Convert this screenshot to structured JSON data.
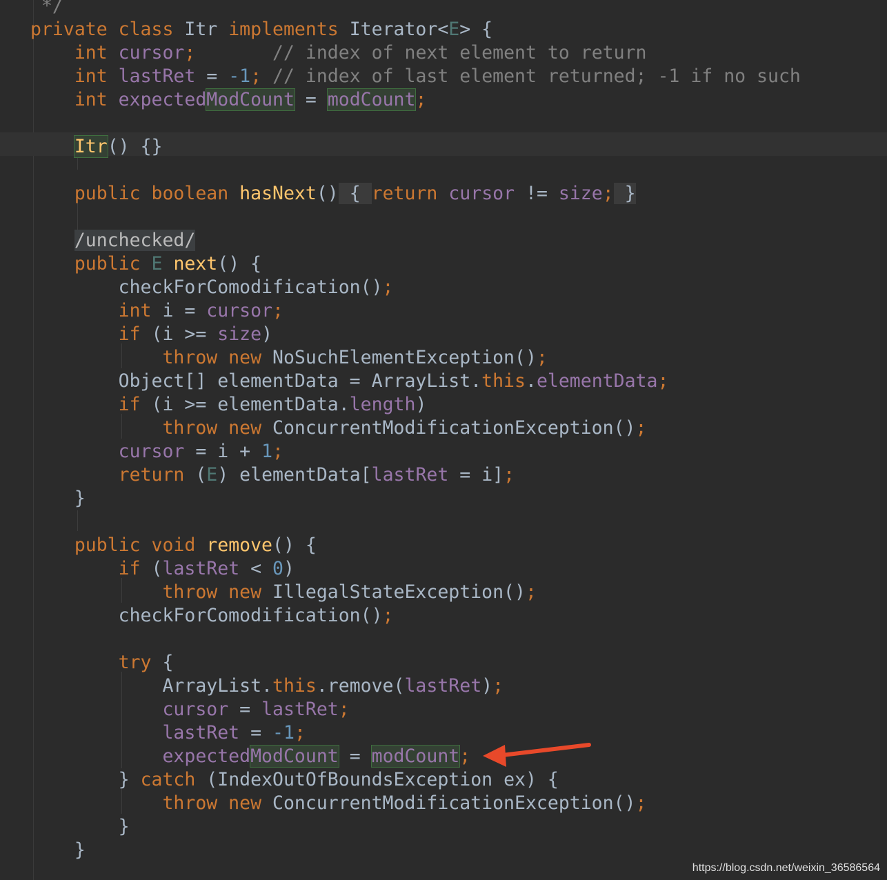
{
  "lines": [
    [
      {
        "t": " */",
        "c": "cmt"
      }
    ],
    [
      {
        "t": "private class ",
        "c": "kw"
      },
      {
        "t": "Itr ",
        "c": "plain"
      },
      {
        "t": "implements ",
        "c": "kw"
      },
      {
        "t": "Iterator<",
        "c": "plain"
      },
      {
        "t": "E",
        "c": "tp"
      },
      {
        "t": "> {",
        "c": "plain"
      }
    ],
    [
      {
        "t": "    "
      },
      {
        "t": "int ",
        "c": "kw"
      },
      {
        "t": "cursor",
        "c": "fld"
      },
      {
        "t": ";",
        "c": "kw"
      },
      {
        "t": "       // index of next element to return",
        "c": "cmt"
      }
    ],
    [
      {
        "t": "    "
      },
      {
        "t": "int ",
        "c": "kw"
      },
      {
        "t": "lastRet",
        "c": "fld"
      },
      {
        "t": " = ",
        "c": "plain"
      },
      {
        "t": "-1",
        "c": "num"
      },
      {
        "t": "; ",
        "c": "kw"
      },
      {
        "t": "// index of last element returned; -1 if no such",
        "c": "cmt"
      }
    ],
    [
      {
        "t": "    "
      },
      {
        "t": "int ",
        "c": "kw"
      },
      {
        "t": "expected",
        "c": "fld"
      },
      {
        "t": "ModCount",
        "c": "fld hl-green"
      },
      {
        "t": " = ",
        "c": "plain"
      },
      {
        "t": "modCount",
        "c": "fld hl-green"
      },
      {
        "t": ";",
        "c": "kw"
      }
    ],
    [],
    [
      {
        "t": "    "
      },
      {
        "t": "Itr",
        "c": "fn hl-green"
      },
      {
        "t": "() {}",
        "c": "plain"
      }
    ],
    [],
    [
      {
        "t": "    "
      },
      {
        "t": "public boolean ",
        "c": "kw"
      },
      {
        "t": "hasNext",
        "c": "fn"
      },
      {
        "t": "()",
        "c": "plain"
      },
      {
        "t": " { ",
        "c": "plain fold-bg"
      },
      {
        "t": "return ",
        "c": "kw"
      },
      {
        "t": "cursor",
        "c": "fld"
      },
      {
        "t": " != ",
        "c": "plain"
      },
      {
        "t": "size",
        "c": "fld"
      },
      {
        "t": ";",
        "c": "kw"
      },
      {
        "t": " }",
        "c": "plain fold-bg"
      }
    ],
    [],
    [
      {
        "t": "    "
      },
      {
        "t": "/unchecked/",
        "c": "annot-bg"
      }
    ],
    [
      {
        "t": "    "
      },
      {
        "t": "public ",
        "c": "kw"
      },
      {
        "t": "E ",
        "c": "tp"
      },
      {
        "t": "next",
        "c": "fn"
      },
      {
        "t": "() {",
        "c": "plain"
      }
    ],
    [
      {
        "t": "        "
      },
      {
        "t": "checkForComodification()",
        "c": "plain"
      },
      {
        "t": ";",
        "c": "kw"
      }
    ],
    [
      {
        "t": "        "
      },
      {
        "t": "int ",
        "c": "kw"
      },
      {
        "t": "i = ",
        "c": "plain"
      },
      {
        "t": "cursor",
        "c": "fld"
      },
      {
        "t": ";",
        "c": "kw"
      }
    ],
    [
      {
        "t": "        "
      },
      {
        "t": "if ",
        "c": "kw"
      },
      {
        "t": "(i >= ",
        "c": "plain"
      },
      {
        "t": "size",
        "c": "fld"
      },
      {
        "t": ")",
        "c": "plain"
      }
    ],
    [
      {
        "t": "            "
      },
      {
        "t": "throw new ",
        "c": "kw"
      },
      {
        "t": "NoSuchElementException()",
        "c": "plain"
      },
      {
        "t": ";",
        "c": "kw"
      }
    ],
    [
      {
        "t": "        "
      },
      {
        "t": "Object[] elementData = ArrayList.",
        "c": "plain"
      },
      {
        "t": "this",
        "c": "kw"
      },
      {
        "t": ".",
        "c": "plain"
      },
      {
        "t": "elementData",
        "c": "fld"
      },
      {
        "t": ";",
        "c": "kw"
      }
    ],
    [
      {
        "t": "        "
      },
      {
        "t": "if ",
        "c": "kw"
      },
      {
        "t": "(i >= elementData.",
        "c": "plain"
      },
      {
        "t": "length",
        "c": "fld"
      },
      {
        "t": ")",
        "c": "plain"
      }
    ],
    [
      {
        "t": "            "
      },
      {
        "t": "throw new ",
        "c": "kw"
      },
      {
        "t": "ConcurrentModificationException()",
        "c": "plain"
      },
      {
        "t": ";",
        "c": "kw"
      }
    ],
    [
      {
        "t": "        "
      },
      {
        "t": "cursor",
        "c": "fld"
      },
      {
        "t": " = i + ",
        "c": "plain"
      },
      {
        "t": "1",
        "c": "num"
      },
      {
        "t": ";",
        "c": "kw"
      }
    ],
    [
      {
        "t": "        "
      },
      {
        "t": "return ",
        "c": "kw"
      },
      {
        "t": "(",
        "c": "plain"
      },
      {
        "t": "E",
        "c": "tp"
      },
      {
        "t": ") elementData[",
        "c": "plain"
      },
      {
        "t": "lastRet",
        "c": "fld"
      },
      {
        "t": " = i]",
        "c": "plain"
      },
      {
        "t": ";",
        "c": "kw"
      }
    ],
    [
      {
        "t": "    "
      },
      {
        "t": "}",
        "c": "plain"
      }
    ],
    [],
    [
      {
        "t": "    "
      },
      {
        "t": "public void ",
        "c": "kw"
      },
      {
        "t": "remove",
        "c": "fn"
      },
      {
        "t": "() {",
        "c": "plain"
      }
    ],
    [
      {
        "t": "        "
      },
      {
        "t": "if ",
        "c": "kw"
      },
      {
        "t": "(",
        "c": "plain"
      },
      {
        "t": "lastRet",
        "c": "fld"
      },
      {
        "t": " < ",
        "c": "plain"
      },
      {
        "t": "0",
        "c": "num"
      },
      {
        "t": ")",
        "c": "plain"
      }
    ],
    [
      {
        "t": "            "
      },
      {
        "t": "throw new ",
        "c": "kw"
      },
      {
        "t": "IllegalStateException()",
        "c": "plain"
      },
      {
        "t": ";",
        "c": "kw"
      }
    ],
    [
      {
        "t": "        "
      },
      {
        "t": "checkForComodification()",
        "c": "plain"
      },
      {
        "t": ";",
        "c": "kw"
      }
    ],
    [],
    [
      {
        "t": "        "
      },
      {
        "t": "try ",
        "c": "kw"
      },
      {
        "t": "{",
        "c": "plain"
      }
    ],
    [
      {
        "t": "            "
      },
      {
        "t": "ArrayList.",
        "c": "plain"
      },
      {
        "t": "this",
        "c": "kw"
      },
      {
        "t": ".remove(",
        "c": "plain"
      },
      {
        "t": "lastRet",
        "c": "fld"
      },
      {
        "t": ")",
        "c": "plain"
      },
      {
        "t": ";",
        "c": "kw"
      }
    ],
    [
      {
        "t": "            "
      },
      {
        "t": "cursor",
        "c": "fld"
      },
      {
        "t": " = ",
        "c": "plain"
      },
      {
        "t": "lastRet",
        "c": "fld"
      },
      {
        "t": ";",
        "c": "kw"
      }
    ],
    [
      {
        "t": "            "
      },
      {
        "t": "lastRet",
        "c": "fld"
      },
      {
        "t": " = ",
        "c": "plain"
      },
      {
        "t": "-1",
        "c": "num"
      },
      {
        "t": ";",
        "c": "kw"
      }
    ],
    [
      {
        "t": "            "
      },
      {
        "t": "expected",
        "c": "fld"
      },
      {
        "t": "ModCount",
        "c": "fld hl-green"
      },
      {
        "t": " = ",
        "c": "plain"
      },
      {
        "t": "modCount",
        "c": "fld hl-green"
      },
      {
        "t": ";",
        "c": "kw"
      }
    ],
    [
      {
        "t": "        "
      },
      {
        "t": "} ",
        "c": "plain"
      },
      {
        "t": "catch ",
        "c": "kw"
      },
      {
        "t": "(IndexOutOfBoundsException ex) {",
        "c": "plain"
      }
    ],
    [
      {
        "t": "            "
      },
      {
        "t": "throw new ",
        "c": "kw"
      },
      {
        "t": "ConcurrentModificationException()",
        "c": "plain"
      },
      {
        "t": ";",
        "c": "kw"
      }
    ],
    [
      {
        "t": "        "
      },
      {
        "t": "}",
        "c": "plain"
      }
    ],
    [
      {
        "t": "    "
      },
      {
        "t": "}",
        "c": "plain"
      }
    ]
  ],
  "watermark": "https://blog.csdn.net/weixin_36586564",
  "colors": {
    "background": "#2b2b2b",
    "keyword": "#cc7832",
    "field": "#9876aa",
    "number": "#6897bb",
    "comment": "#808080",
    "method": "#ffc66d",
    "type_param": "#507874",
    "arrow": "#e8492a"
  },
  "annotation": {
    "icon": "red-arrow-icon",
    "points_to_line": 32
  }
}
